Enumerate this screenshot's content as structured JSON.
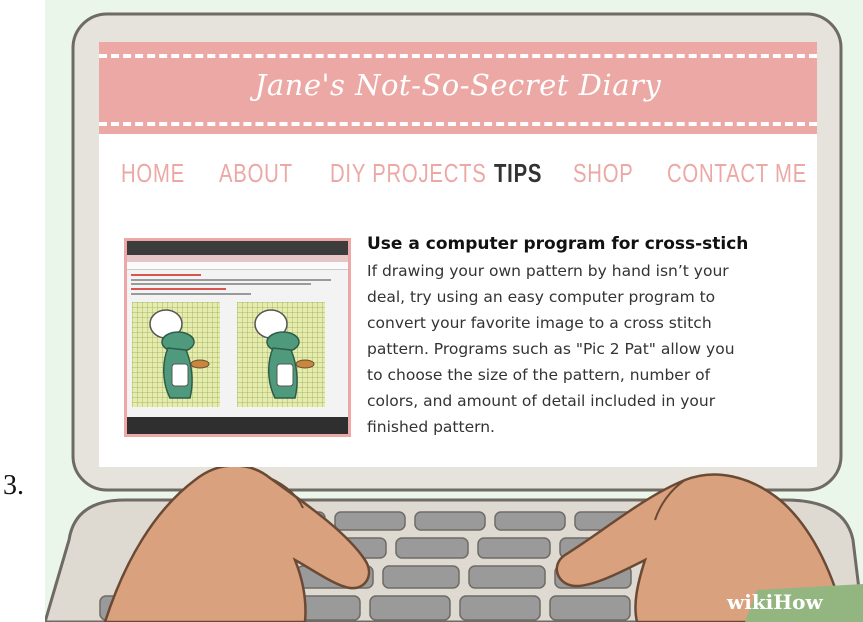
{
  "step_number": "3.",
  "website": {
    "title": "Jane's Not-So-Secret Diary",
    "nav": [
      {
        "label": "HOME",
        "active": false
      },
      {
        "label": "ABOUT",
        "active": false
      },
      {
        "label": "DIY PROJECTS",
        "active": false
      },
      {
        "label": "TIPS",
        "active": true
      },
      {
        "label": "SHOP",
        "active": false
      },
      {
        "label": "CONTACT ME",
        "active": false
      }
    ],
    "tip": {
      "title": "Use a computer program for cross-stich",
      "body_lines": [
        "If drawing your own pattern by hand isn’t your",
        "deal, try using an easy computer program to",
        "convert your favorite image to a cross stitch",
        "pattern. Programs such as \"Pic 2 Pat\" allow you",
        "to choose the size of the pattern, number of",
        "colors, and amount of detail included in your",
        "finished pattern."
      ]
    }
  },
  "brand": {
    "prefix": "wiki",
    "suffix": "How"
  },
  "colors": {
    "background": "#eaf6ea",
    "banner": "#eca8a5",
    "nav_text": "#eca8a5",
    "nav_active": "#333333",
    "laptop_frame": "#e6e3dc",
    "laptop_outline": "#6f6a64",
    "keyboard": "#8c8c8c",
    "hands": "#d9a17d",
    "brand_bar": "#93b580"
  },
  "icons": [
    "dinosaur-chef-image",
    "hands-illustration",
    "laptop-illustration"
  ]
}
